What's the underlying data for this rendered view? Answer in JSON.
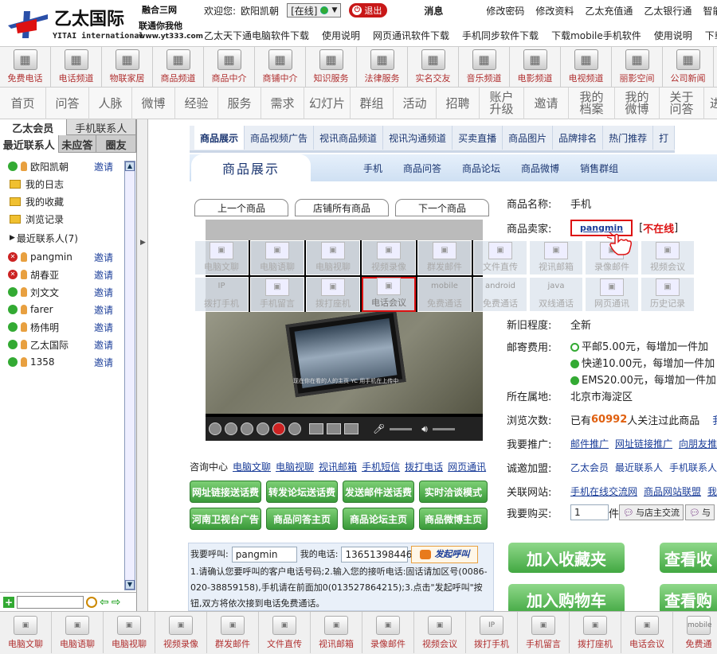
{
  "brand": {
    "name_cn": "乙太国际",
    "name_en": "YITAI international",
    "slogan1": "融合三网",
    "slogan2": "联通你我他",
    "url": "www.yt333.com"
  },
  "user": {
    "welcome": "欢迎您:",
    "name": "欧阳凯朝",
    "status": "[在线]",
    "logout": "退出",
    "messages": "消息"
  },
  "top_links": [
    "修改密码",
    "修改资料",
    "乙太充值通",
    "乙太银行通",
    "智能客服"
  ],
  "download_links": [
    "乙太天下通电脑软件下载",
    "使用说明",
    "网页通讯软件下载",
    "手机同步软件下载",
    "下载mobile手机软件",
    "使用说明",
    "下载"
  ],
  "icon_bar": [
    "免费电话",
    "电话频道",
    "物联家居",
    "商品频道",
    "商品中介",
    "商铺中介",
    "知识服务",
    "法律服务",
    "实名交友",
    "音乐频道",
    "电影频道",
    "电视频道",
    "丽影空间",
    "公司新闻"
  ],
  "nav_bar": [
    "首页",
    "问答",
    "人脉",
    "微博",
    "经验",
    "服务",
    "需求",
    "幻灯片",
    "群组",
    "活动",
    "招聘",
    "账户升级",
    "邀请",
    "我的档案",
    "我的微博",
    "关于问答",
    "进"
  ],
  "sidebar": {
    "tabs_top": [
      "乙太会员",
      "手机联系人"
    ],
    "tabs_second": [
      "最近联系人",
      "未应答",
      "圈友"
    ],
    "entries": [
      {
        "type": "contact",
        "status": "online",
        "name": "欧阳凯朝",
        "invite": "邀请"
      },
      {
        "type": "folder",
        "name": "我的日志"
      },
      {
        "type": "folder",
        "name": "我的收藏"
      },
      {
        "type": "folder",
        "name": "浏览记录"
      },
      {
        "type": "group",
        "name": "最近联系人(7)"
      },
      {
        "type": "contact",
        "status": "offline",
        "name": "pangmin",
        "invite": "邀请"
      },
      {
        "type": "contact",
        "status": "offline",
        "name": "胡春亚",
        "invite": "邀请"
      },
      {
        "type": "contact",
        "status": "online",
        "name": "刘文文",
        "invite": "邀请"
      },
      {
        "type": "contact",
        "status": "online",
        "name": "farer",
        "invite": "邀请"
      },
      {
        "type": "contact",
        "status": "online",
        "name": "杨伟明",
        "invite": "邀请"
      },
      {
        "type": "contact",
        "status": "online",
        "name": "乙太国际",
        "invite": "邀请"
      },
      {
        "type": "contact",
        "status": "online",
        "name": "1358",
        "invite": "邀请"
      }
    ]
  },
  "content_tabs": [
    "商品展示",
    "商品视频广告",
    "视讯商品频道",
    "视讯沟通频道",
    "买卖直播",
    "商品图片",
    "品牌排名",
    "热门推荐",
    "打"
  ],
  "section": {
    "title": "商品展示",
    "links": [
      "手机",
      "商品问答",
      "商品论坛",
      "商品微博",
      "销售群组"
    ]
  },
  "product_nav": [
    "上一个商品",
    "店铺所有商品",
    "下一个商品"
  ],
  "video": {
    "caption": "现在你在看的人的主页 YC 用手机在上传中"
  },
  "overlay_icons": [
    {
      "label": "电脑文聊",
      "sub": ""
    },
    {
      "label": "电脑语聊",
      "sub": ""
    },
    {
      "label": "电脑视聊",
      "sub": ""
    },
    {
      "label": "视频录像",
      "sub": ""
    },
    {
      "label": "群发邮件",
      "sub": ""
    },
    {
      "label": "文件直传",
      "sub": ""
    },
    {
      "label": "视讯邮箱",
      "sub": ""
    },
    {
      "label": "录像邮件",
      "sub": ""
    },
    {
      "label": "视频会议",
      "sub": ""
    },
    {
      "label": "拨打手机",
      "sub": "IP"
    },
    {
      "label": "手机留言",
      "sub": ""
    },
    {
      "label": "拨打座机",
      "sub": ""
    },
    {
      "label": "电话会议",
      "sub": ""
    },
    {
      "label": "免费通话",
      "sub": "mobile"
    },
    {
      "label": "免费通话",
      "sub": "android"
    },
    {
      "label": "双线通话",
      "sub": "java"
    },
    {
      "label": "网页通讯",
      "sub": ""
    },
    {
      "label": "历史记录",
      "sub": ""
    }
  ],
  "consult": {
    "label": "咨询中心",
    "links": [
      "电脑文聊",
      "电脑视聊",
      "视讯邮箱",
      "手机短信",
      "拨打电话",
      "网页通讯"
    ]
  },
  "green_buttons": [
    "网址链接送话费",
    "转发论坛送话费",
    "发送邮件送话费",
    "实时洽谈模式",
    "河南卫视台广告",
    "商品问答主页",
    "商品论坛主页",
    "商品微博主页"
  ],
  "call": {
    "label_call": "我要呼叫:",
    "callee": "pangmin",
    "label_phone": "我的电话:",
    "phone": "13651398446",
    "button": "发起呼叫",
    "note": "1.请确认您要呼叫的客户电话号码;2.输入您的接听电话:固话请加区号(0086-020-38859158),手机请在前面加0(013527864215);3.点击\"发起呼叫\"按钮,双方将依次接到电话免费通话。"
  },
  "info": {
    "name_label": "商品名称:",
    "name": "手机",
    "seller_label": "商品卖家:",
    "seller": "pangmin",
    "seller_status": "不在线",
    "condition_label": "新旧程度:",
    "condition": "全新",
    "shipping_label": "邮寄费用:",
    "shipping": [
      "平邮5.00元，每增加一件加",
      "快递10.00元，每增加一件加",
      "EMS20.00元，每增加一件加"
    ],
    "location_label": "所在属地:",
    "location": "北京市海淀区",
    "views_label": "浏览次数:",
    "views_pre": "已有",
    "views_num": "60992",
    "views_post": "人关注过此商品",
    "views_tail": "我",
    "promote_label": "我要推广:",
    "promote": [
      "邮件推广",
      "网址链接推广",
      "向朋友推"
    ],
    "invite_label": "诚邀加盟:",
    "invite": [
      "乙太会员",
      "最近联系人",
      "手机联系人"
    ],
    "related_label": "关联网站:",
    "related": [
      "手机在线交流网",
      "商品网站联盟",
      "我"
    ],
    "buy_label": "我要购买:",
    "qty": "1",
    "unit": "件",
    "chat": "与店主交流",
    "chat2": "与"
  },
  "big_buttons": [
    "加入收藏夹",
    "查看收",
    "加入购物车",
    "查看购"
  ],
  "bottom_bar": [
    {
      "label": "电脑文聊",
      "sub": ""
    },
    {
      "label": "电脑语聊",
      "sub": ""
    },
    {
      "label": "电脑视聊",
      "sub": ""
    },
    {
      "label": "视频录像",
      "sub": ""
    },
    {
      "label": "群发邮件",
      "sub": ""
    },
    {
      "label": "文件直传",
      "sub": ""
    },
    {
      "label": "视讯邮箱",
      "sub": ""
    },
    {
      "label": "录像邮件",
      "sub": ""
    },
    {
      "label": "视频会议",
      "sub": ""
    },
    {
      "label": "拨打手机",
      "sub": "IP"
    },
    {
      "label": "手机留言",
      "sub": ""
    },
    {
      "label": "拨打座机",
      "sub": ""
    },
    {
      "label": "电话会议",
      "sub": ""
    },
    {
      "label": "免费通",
      "sub": "mobile"
    }
  ]
}
